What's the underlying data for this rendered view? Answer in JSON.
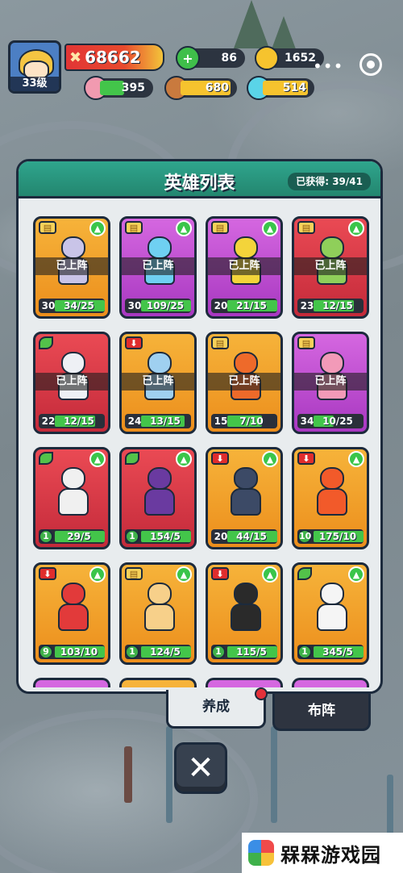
{
  "player": {
    "level_label": "33级",
    "power": "68662"
  },
  "resources": {
    "gems": "86",
    "gold": "1652",
    "meat": "395",
    "wood": "680",
    "crystal": "514"
  },
  "panel": {
    "title": "英雄列表",
    "obtained_label": "已获得: 39/41",
    "on_team_label": "已上阵"
  },
  "heroes": [
    {
      "rarity": "orange",
      "badge": "book",
      "level": "30",
      "fragments": "34/25",
      "on_team": true,
      "upgrade": true,
      "progress": 1.0,
      "color": "#c9c4e8"
    },
    {
      "rarity": "purple",
      "badge": "book",
      "level": "30",
      "fragments": "109/25",
      "on_team": true,
      "upgrade": true,
      "progress": 1.0,
      "color": "#6fd0f2"
    },
    {
      "rarity": "purple",
      "badge": "book",
      "level": "20",
      "fragments": "21/15",
      "on_team": true,
      "upgrade": true,
      "progress": 1.0,
      "color": "#f3d43a"
    },
    {
      "rarity": "red",
      "badge": "book",
      "level": "23",
      "fragments": "12/15",
      "on_team": true,
      "upgrade": true,
      "progress": 0.8,
      "color": "#8fcf5a"
    },
    {
      "rarity": "red",
      "badge": "leaf",
      "level": "22",
      "fragments": "12/15",
      "on_team": true,
      "upgrade": false,
      "progress": 0.8,
      "color": "#eef0f5"
    },
    {
      "rarity": "orange",
      "badge": "down",
      "level": "24",
      "fragments": "13/15",
      "on_team": true,
      "upgrade": false,
      "progress": 0.87,
      "color": "#9fd0f0"
    },
    {
      "rarity": "orange",
      "badge": "book",
      "level": "15",
      "fragments": "7/10",
      "on_team": true,
      "upgrade": false,
      "progress": 0.7,
      "color": "#ee6a2a"
    },
    {
      "rarity": "purple",
      "badge": "book",
      "level": "34",
      "fragments": "10/25",
      "on_team": true,
      "upgrade": false,
      "progress": 0.4,
      "color": "#f29ab8"
    },
    {
      "rarity": "red",
      "badge": "leaf",
      "level": "1",
      "fragments": "29/5",
      "on_team": false,
      "upgrade": true,
      "progress": 1.0,
      "color": "#f0f0f0"
    },
    {
      "rarity": "red",
      "badge": "leaf",
      "level": "1",
      "fragments": "154/5",
      "on_team": false,
      "upgrade": true,
      "progress": 1.0,
      "color": "#6a3aa0"
    },
    {
      "rarity": "orange",
      "badge": "down",
      "level": "20",
      "fragments": "44/15",
      "on_team": false,
      "upgrade": true,
      "progress": 1.0,
      "color": "#3c4a66"
    },
    {
      "rarity": "orange",
      "badge": "down",
      "level": "10",
      "fragments": "175/10",
      "on_team": false,
      "upgrade": true,
      "progress": 1.0,
      "color": "#f25a2a"
    },
    {
      "rarity": "orange",
      "badge": "down",
      "level": "9",
      "fragments": "103/10",
      "on_team": false,
      "upgrade": true,
      "progress": 1.0,
      "color": "#e23a3a"
    },
    {
      "rarity": "orange",
      "badge": "book",
      "level": "1",
      "fragments": "124/5",
      "on_team": false,
      "upgrade": true,
      "progress": 1.0,
      "color": "#f7d08a"
    },
    {
      "rarity": "orange",
      "badge": "down",
      "level": "1",
      "fragments": "115/5",
      "on_team": false,
      "upgrade": true,
      "progress": 1.0,
      "color": "#2a2a2a"
    },
    {
      "rarity": "orange",
      "badge": "leaf",
      "level": "1",
      "fragments": "345/5",
      "on_team": false,
      "upgrade": true,
      "progress": 1.0,
      "color": "#f5f5f5"
    }
  ],
  "partial_row": [
    "purple",
    "orange",
    "purple",
    "purple"
  ],
  "tabs": {
    "develop": "养成",
    "formation": "布阵"
  },
  "close_symbol": "✕",
  "watermark": "槑槑游戏园"
}
